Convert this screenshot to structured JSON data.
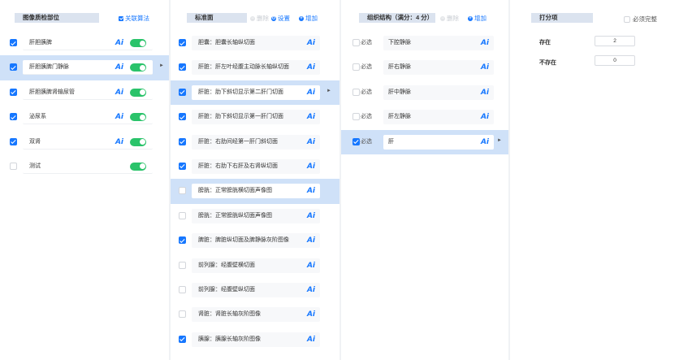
{
  "panel1": {
    "title": "图像质检部位",
    "link_label": "关联算法",
    "items": [
      {
        "label": "肝胆胰脾",
        "checked": true,
        "ai": true,
        "toggle": true,
        "selected": false
      },
      {
        "label": "肝胆胰脾门静脉",
        "checked": true,
        "ai": true,
        "toggle": true,
        "selected": true
      },
      {
        "label": "肝胆胰脾肾输尿管",
        "checked": true,
        "ai": true,
        "toggle": true,
        "selected": false
      },
      {
        "label": "泌尿系",
        "checked": true,
        "ai": true,
        "toggle": true,
        "selected": false
      },
      {
        "label": "双肾",
        "checked": true,
        "ai": true,
        "toggle": true,
        "selected": false
      },
      {
        "label": "测试",
        "checked": false,
        "ai": false,
        "toggle": true,
        "selected": false
      }
    ]
  },
  "panel2": {
    "title": "标准面",
    "delete_label": "删除",
    "settings_label": "设置",
    "add_label": "增加",
    "items": [
      {
        "label": "胆囊：胆囊长轴纵切面",
        "checked": true,
        "selected": false
      },
      {
        "label": "肝脏：肝左叶经腹主动脉长轴纵切面",
        "checked": true,
        "selected": false
      },
      {
        "label": "肝脏：肋下斜切显示第二肝门切面",
        "checked": true,
        "selected": true
      },
      {
        "label": "肝脏：肋下斜切显示第一肝门切面",
        "checked": true,
        "selected": false
      },
      {
        "label": "肝脏：右肋间经第一肝门斜切面",
        "checked": true,
        "selected": false
      },
      {
        "label": "肝脏：右肋下右肝及右肾纵切面",
        "checked": true,
        "selected": false
      },
      {
        "label": "膀胱：正常膀胱横切面声像图",
        "checked": false,
        "selected": false,
        "highlight": true
      },
      {
        "label": "膀胱：正常膀胱纵切面声像图",
        "checked": false,
        "selected": false
      },
      {
        "label": "脾脏：脾脏纵切面及脾静脉灰阶图像",
        "checked": true,
        "selected": false
      },
      {
        "label": "前列腺：经腹壁横切面",
        "checked": false,
        "selected": false
      },
      {
        "label": "前列腺：经腹壁纵切面",
        "checked": false,
        "selected": false
      },
      {
        "label": "肾脏：肾脏长轴灰阶图像",
        "checked": false,
        "selected": false
      },
      {
        "label": "胰腺：胰腺长轴灰阶图像",
        "checked": true,
        "selected": false
      }
    ]
  },
  "panel3": {
    "title": "组织结构（满分：4 分）",
    "delete_label": "删除",
    "add_label": "增加",
    "must_label": "必选",
    "items": [
      {
        "label": "下腔静脉",
        "checked": false,
        "selected": false
      },
      {
        "label": "肝右静脉",
        "checked": false,
        "selected": false
      },
      {
        "label": "肝中静脉",
        "checked": false,
        "selected": false
      },
      {
        "label": "肝左静脉",
        "checked": false,
        "selected": false
      },
      {
        "label": "肝",
        "checked": true,
        "selected": true
      }
    ]
  },
  "panel4": {
    "title": "打分项",
    "must_complete_label": "必须完整",
    "items": [
      {
        "label": "存在",
        "value": "2"
      },
      {
        "label": "不存在",
        "value": "0"
      }
    ]
  },
  "ai_text": "Ai",
  "arrow_glyph": "►",
  "colors": {
    "accent": "#1677ff",
    "toggle_on": "#2ac36a",
    "selected_row": "#cfe1f8",
    "header_bg": "#dbe3ef"
  }
}
